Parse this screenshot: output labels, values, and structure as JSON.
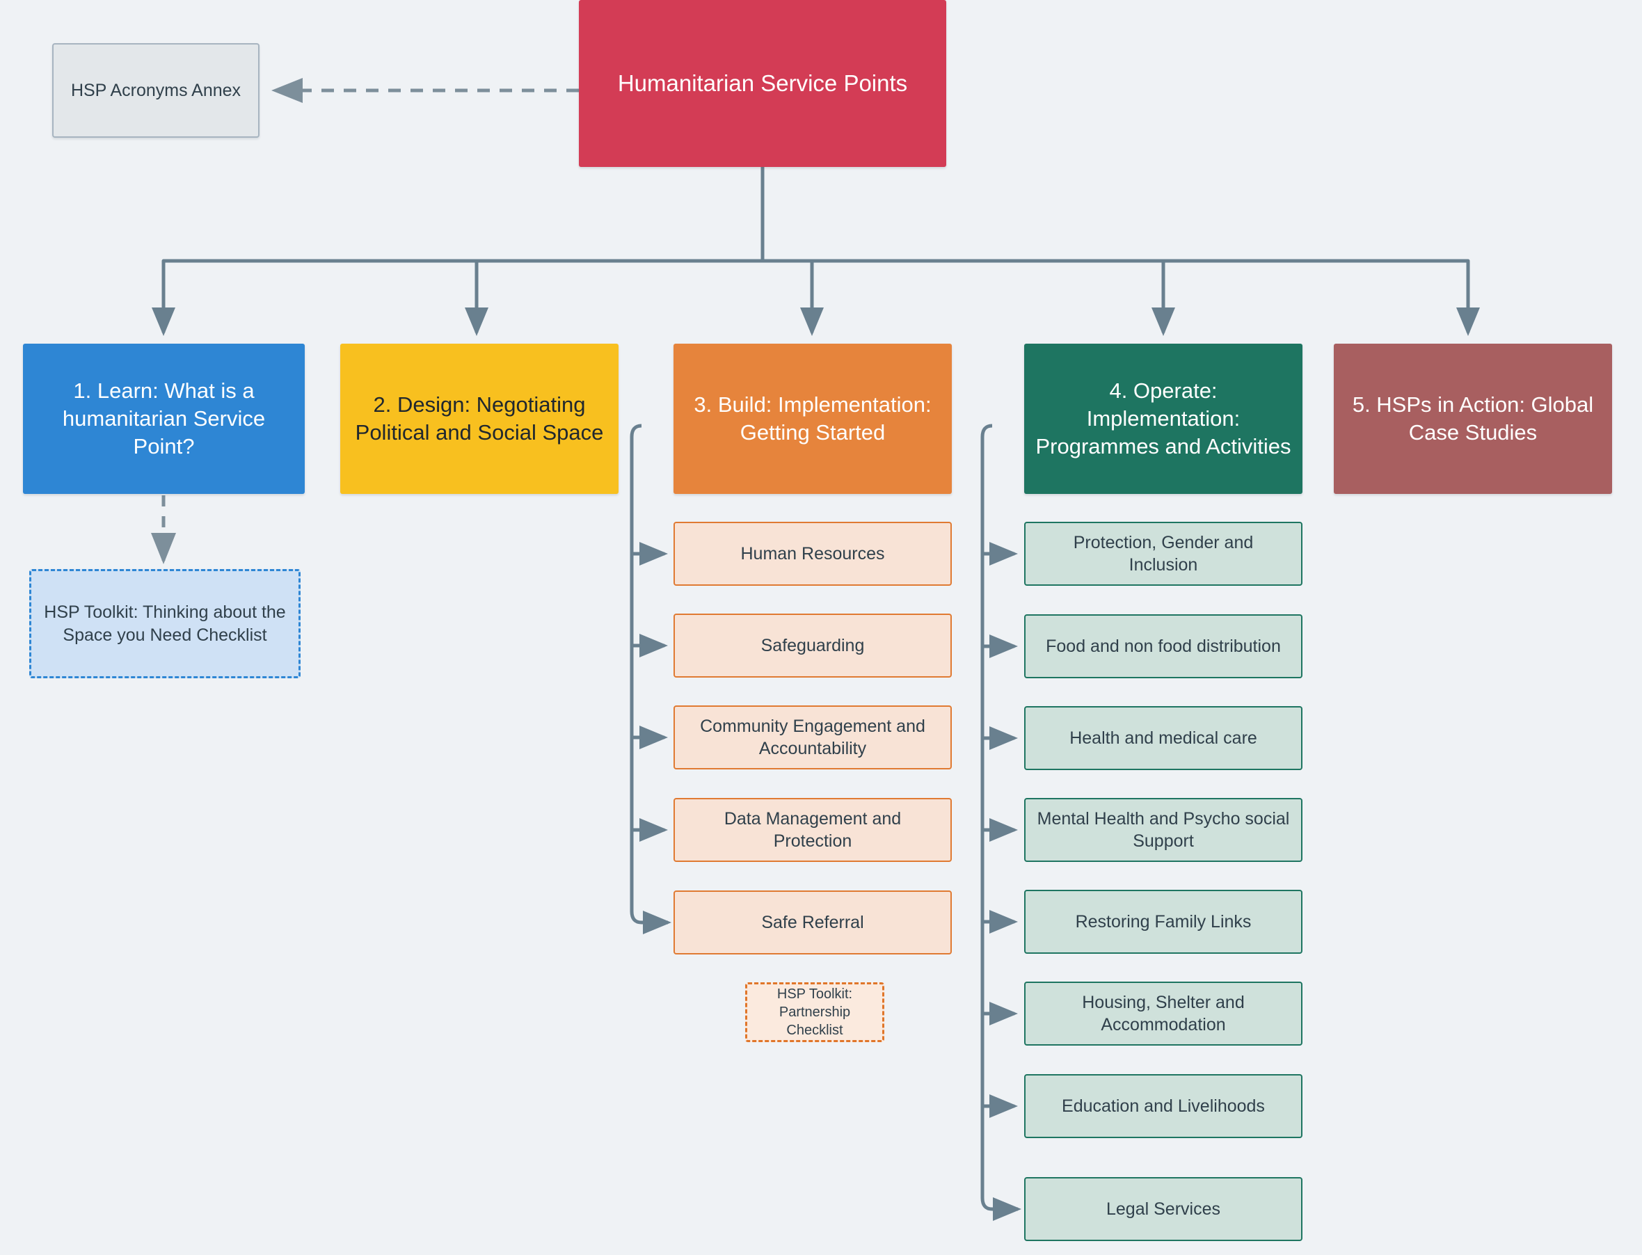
{
  "diagram": {
    "background_color": "#eff2f5",
    "edge_color": "#69808f",
    "root": {
      "label": "Humanitarian Service Points",
      "color": "#d33c55"
    },
    "annex": {
      "label": "HSP Acronyms Annex",
      "color": "#e3e7ea"
    },
    "branches": [
      {
        "id": "learn",
        "label": "1. Learn: What is a humanitarian Service Point?",
        "color": "#2e86d4",
        "note": {
          "label": "HSP Toolkit: Thinking about the Space you Need Checklist",
          "color": "#cfe1f5"
        },
        "children": []
      },
      {
        "id": "design",
        "label": "2. Design: Negotiating Political and Social Space",
        "color": "#f8c01f",
        "children": []
      },
      {
        "id": "build",
        "label": "3. Build: Implementation: Getting Started",
        "color": "#e6843c",
        "child_fill": "#f8e3d6",
        "children": [
          "Human Resources",
          "Safeguarding",
          "Community Engagement and Accountability",
          "Data Management and Protection",
          "Safe Referral"
        ],
        "note": {
          "label": "HSP Toolkit:\nPartnership Checklist",
          "color": "#fbeade"
        }
      },
      {
        "id": "operate",
        "label": "4. Operate: Implementation: Programmes and Activities",
        "color": "#1e7561",
        "child_fill": "#cfe1db",
        "children": [
          "Protection, Gender and Inclusion",
          "Food and non food distribution",
          "Health and medical care",
          "Mental Health and Psycho social Support",
          "Restoring Family Links",
          "Housing, Shelter and Accommodation",
          "Education and Livelihoods",
          "Legal Services"
        ]
      },
      {
        "id": "action",
        "label": "5. HSPs in Action: Global Case Studies",
        "color": "#a85f60",
        "children": []
      }
    ]
  }
}
